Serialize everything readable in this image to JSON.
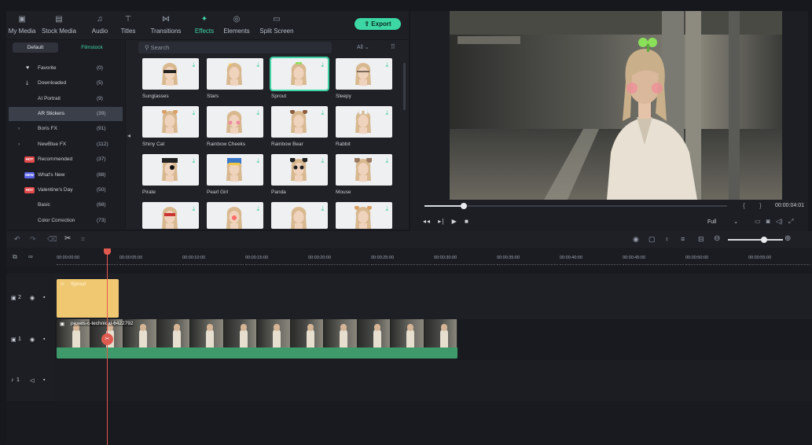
{
  "toolbar": {
    "tabs": [
      {
        "label": "My Media",
        "icon": "media-icon"
      },
      {
        "label": "Stock Media",
        "icon": "stock-icon"
      },
      {
        "label": "Audio",
        "icon": "music-icon"
      },
      {
        "label": "Titles",
        "icon": "titles-icon"
      },
      {
        "label": "Transitions",
        "icon": "transitions-icon"
      },
      {
        "label": "Effects",
        "icon": "effects-icon",
        "active": true
      },
      {
        "label": "Elements",
        "icon": "elements-icon"
      },
      {
        "label": "Split Screen",
        "icon": "split-icon"
      }
    ],
    "export_label": "Export"
  },
  "category_panel": {
    "segments": [
      "Default",
      "Filmstock"
    ],
    "items": [
      {
        "name": "Favorite",
        "count": "(0)",
        "icon": "heart-icon"
      },
      {
        "name": "Downloaded",
        "count": "(5)",
        "icon": "download-icon"
      },
      {
        "name": "AI Portrait",
        "count": "(9)"
      },
      {
        "name": "AR Stickers",
        "count": "(39)",
        "selected": true
      },
      {
        "name": "Boris FX",
        "count": "(91)",
        "chevron": true
      },
      {
        "name": "NewBlue FX",
        "count": "(112)",
        "chevron": true
      },
      {
        "name": "Recommended",
        "count": "(37)",
        "badge": "HOT"
      },
      {
        "name": "What's New",
        "count": "(88)",
        "badge": "NEW"
      },
      {
        "name": "Valentine's Day",
        "count": "(50)",
        "badge": "HOT"
      },
      {
        "name": "Basic",
        "count": "(68)"
      },
      {
        "name": "Color Correction",
        "count": "(73)"
      }
    ]
  },
  "effects_grid": {
    "search_placeholder": "Search",
    "filter_label": "All",
    "cards": [
      {
        "label": "Sunglasses"
      },
      {
        "label": "Stars"
      },
      {
        "label": "Sprout",
        "selected": true
      },
      {
        "label": "Sleepy"
      },
      {
        "label": "Shiny Cat"
      },
      {
        "label": "Rainbow Cheeks"
      },
      {
        "label": "Rainbow Bear"
      },
      {
        "label": "Rabbit"
      },
      {
        "label": "Pirate"
      },
      {
        "label": "Pearl Girl"
      },
      {
        "label": "Panda"
      },
      {
        "label": "Mouse"
      },
      {
        "label": ""
      },
      {
        "label": ""
      },
      {
        "label": ""
      },
      {
        "label": ""
      }
    ]
  },
  "player": {
    "timecode": "00:00:04:01",
    "quality": "Full",
    "progress_fraction": 0.13
  },
  "timeline": {
    "ruler_ticks": [
      "00:00:00:00",
      "00:00:05:00",
      "00:00:10:00",
      "00:00:15:00",
      "00:00:20:00",
      "00:00:25:00",
      "00:00:30:00",
      "00:00:35:00",
      "00:00:40:00",
      "00:00:45:00",
      "00:00:50:00",
      "00:00:55:00"
    ],
    "tracks": [
      {
        "label": "2",
        "type": "video"
      },
      {
        "label": "1",
        "type": "video"
      },
      {
        "label": "1",
        "type": "audio"
      }
    ],
    "sticker_clip": "Sprout",
    "video_clip": "pexels-c-technical-6422792"
  }
}
